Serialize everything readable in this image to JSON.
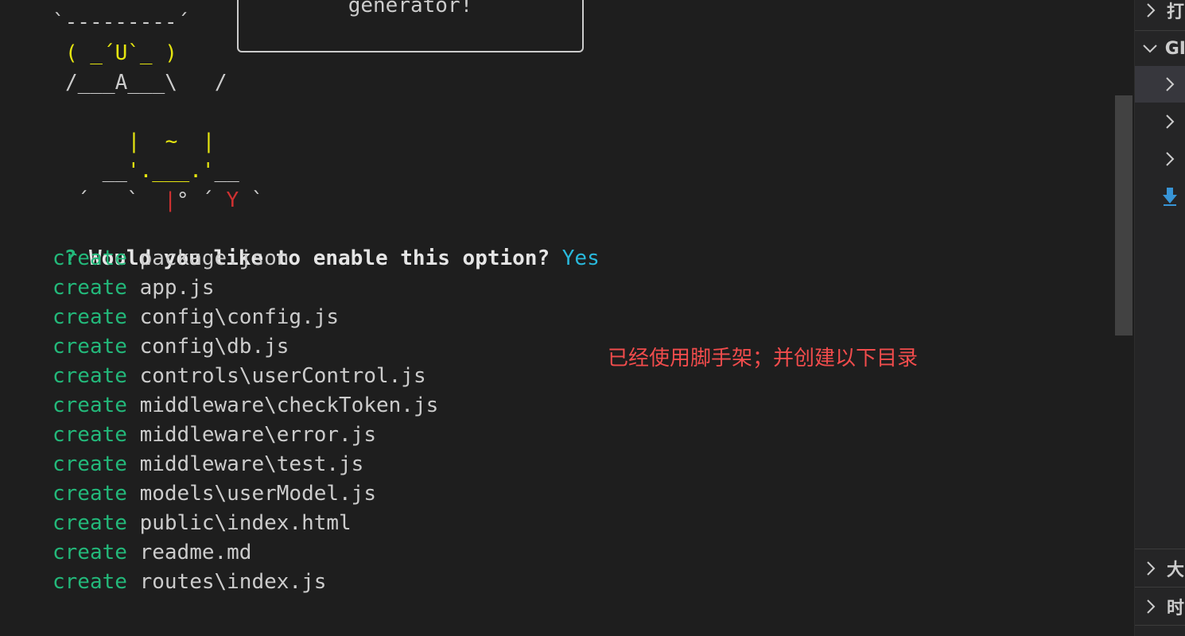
{
  "terminal": {
    "ascii_top_line": "`---------´",
    "banner_text": "generator!",
    "ascii_face": "( _´U`_ )",
    "ascii_body": "/___A___\\   /",
    "ascii_belly_left": "|",
    "ascii_belly_mid": "~",
    "ascii_belly_right": "|",
    "ascii_base_left": "__",
    "ascii_base_mid": "'.___.'",
    "ascii_base_right": "__",
    "ascii_feet_left": "´   `  ",
    "ascii_feet_mid": "|",
    "ascii_feet_text": "° ´",
    "ascii_feet_y": "Y",
    "ascii_feet_right": " `",
    "prompt": {
      "marker": "?",
      "question": "Would you like to enable this option?",
      "answer": "Yes"
    },
    "files": [
      {
        "verb": "create",
        "path": "package.json"
      },
      {
        "verb": "create",
        "path": "app.js"
      },
      {
        "verb": "create",
        "path": "config\\config.js"
      },
      {
        "verb": "create",
        "path": "config\\db.js"
      },
      {
        "verb": "create",
        "path": "controls\\userControl.js"
      },
      {
        "verb": "create",
        "path": "middleware\\checkToken.js"
      },
      {
        "verb": "create",
        "path": "middleware\\error.js"
      },
      {
        "verb": "create",
        "path": "middleware\\test.js"
      },
      {
        "verb": "create",
        "path": "models\\userModel.js"
      },
      {
        "verb": "create",
        "path": "public\\index.html"
      },
      {
        "verb": "create",
        "path": "readme.md"
      },
      {
        "verb": "create",
        "path": "routes\\index.js"
      }
    ]
  },
  "annotation": "已经使用脚手架；并创建以下目录",
  "side_panel": {
    "rows": [
      {
        "icon": "chevron-right-icon",
        "label": "打"
      },
      {
        "icon": "chevron-down-icon",
        "label": "GI"
      },
      {
        "icon": "chevron-right-icon",
        "label": ""
      },
      {
        "icon": "chevron-right-icon",
        "label": ""
      },
      {
        "icon": "chevron-right-icon",
        "label": ""
      },
      {
        "icon": "download-arrow-icon",
        "label": ""
      },
      {
        "icon": "chevron-right-icon",
        "label": "大"
      },
      {
        "icon": "chevron-right-icon",
        "label": "时"
      }
    ]
  },
  "colors": {
    "background": "#1e1e1e",
    "green": "#23b87a",
    "cyan": "#29b8db",
    "yellow": "#e5e510",
    "red": "#cd3131",
    "annotation_red": "#f14c4c"
  }
}
